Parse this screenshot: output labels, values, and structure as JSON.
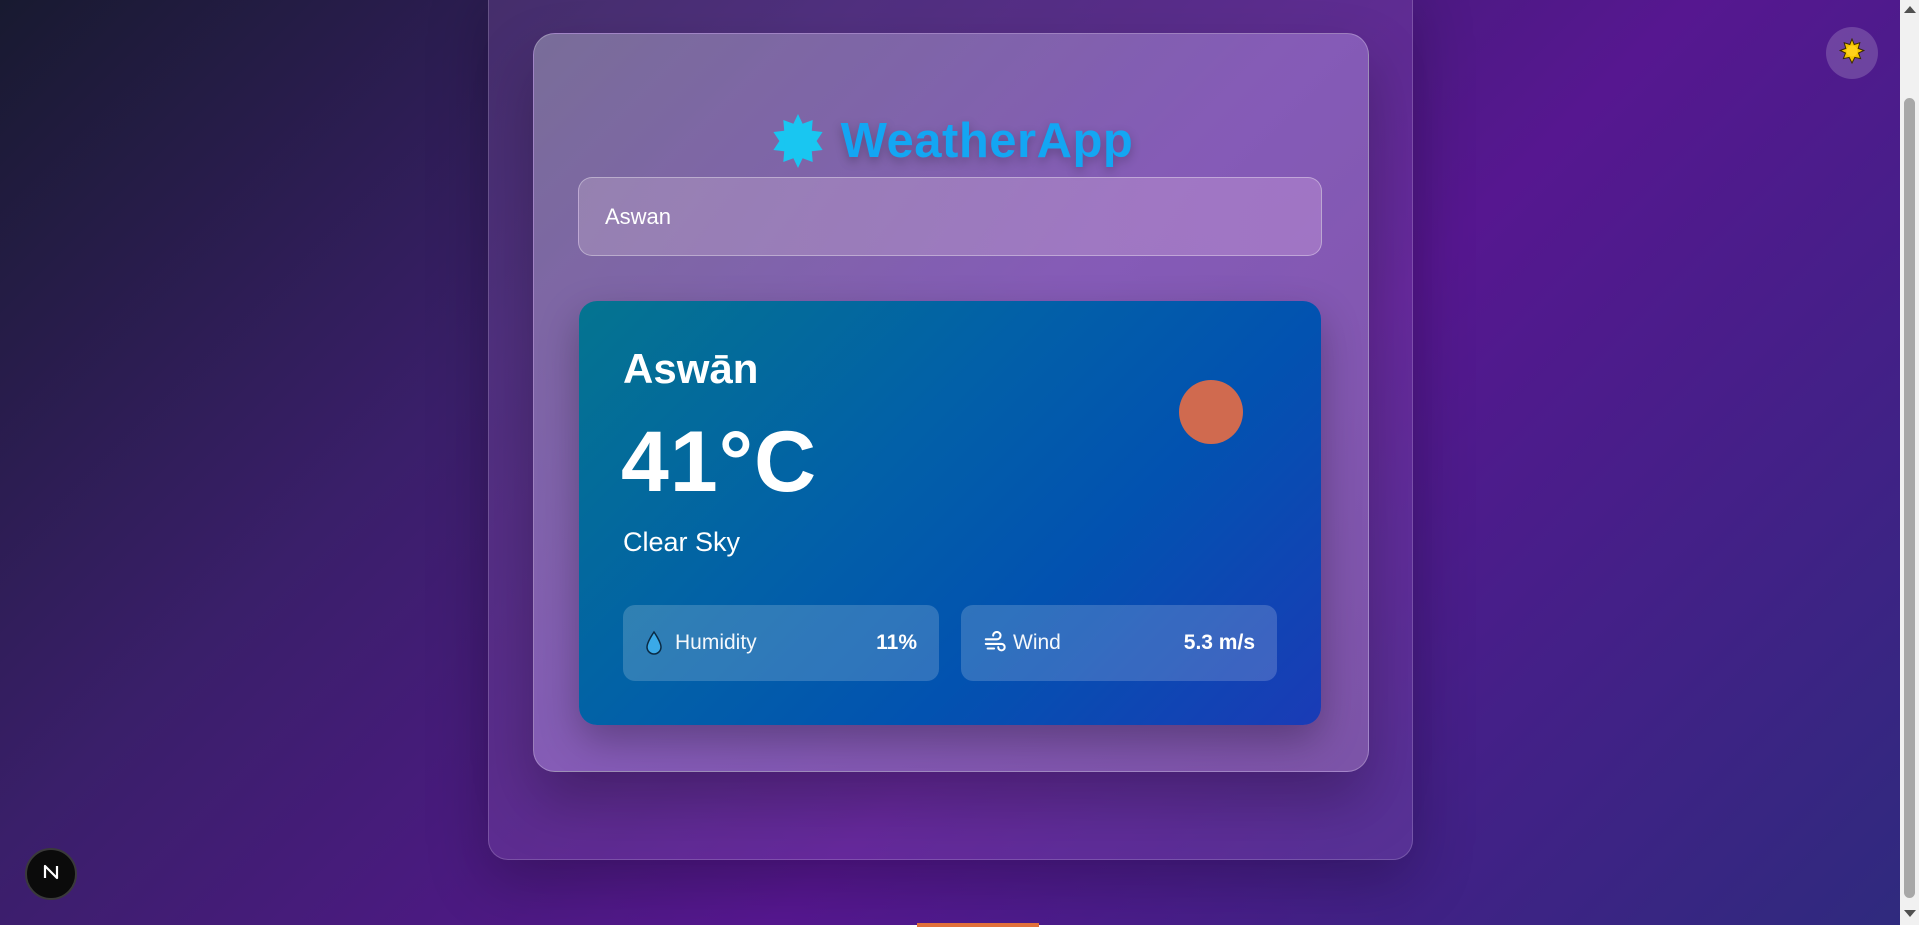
{
  "app": {
    "title": "WeatherApp",
    "brand_icon": "sun-badge-icon"
  },
  "search": {
    "value": "Aswan"
  },
  "weather": {
    "city": "Aswān",
    "temperature": "41°C",
    "description": "Clear Sky",
    "condition_icon": "sun-circle-icon",
    "stats": {
      "humidity": {
        "label": "Humidity",
        "value": "11%",
        "icon": "droplet-icon"
      },
      "wind": {
        "label": "Wind",
        "value": "5.3 m/s",
        "icon": "wind-icon"
      }
    }
  },
  "theme_toggle": {
    "icon": "sun-icon"
  },
  "framework_badge": {
    "icon": "next-logo-icon"
  },
  "colors": {
    "brand": "#13a6f3",
    "sun": "#d06a4f",
    "card_start": "#047490",
    "card_end": "#1a3bb6"
  }
}
